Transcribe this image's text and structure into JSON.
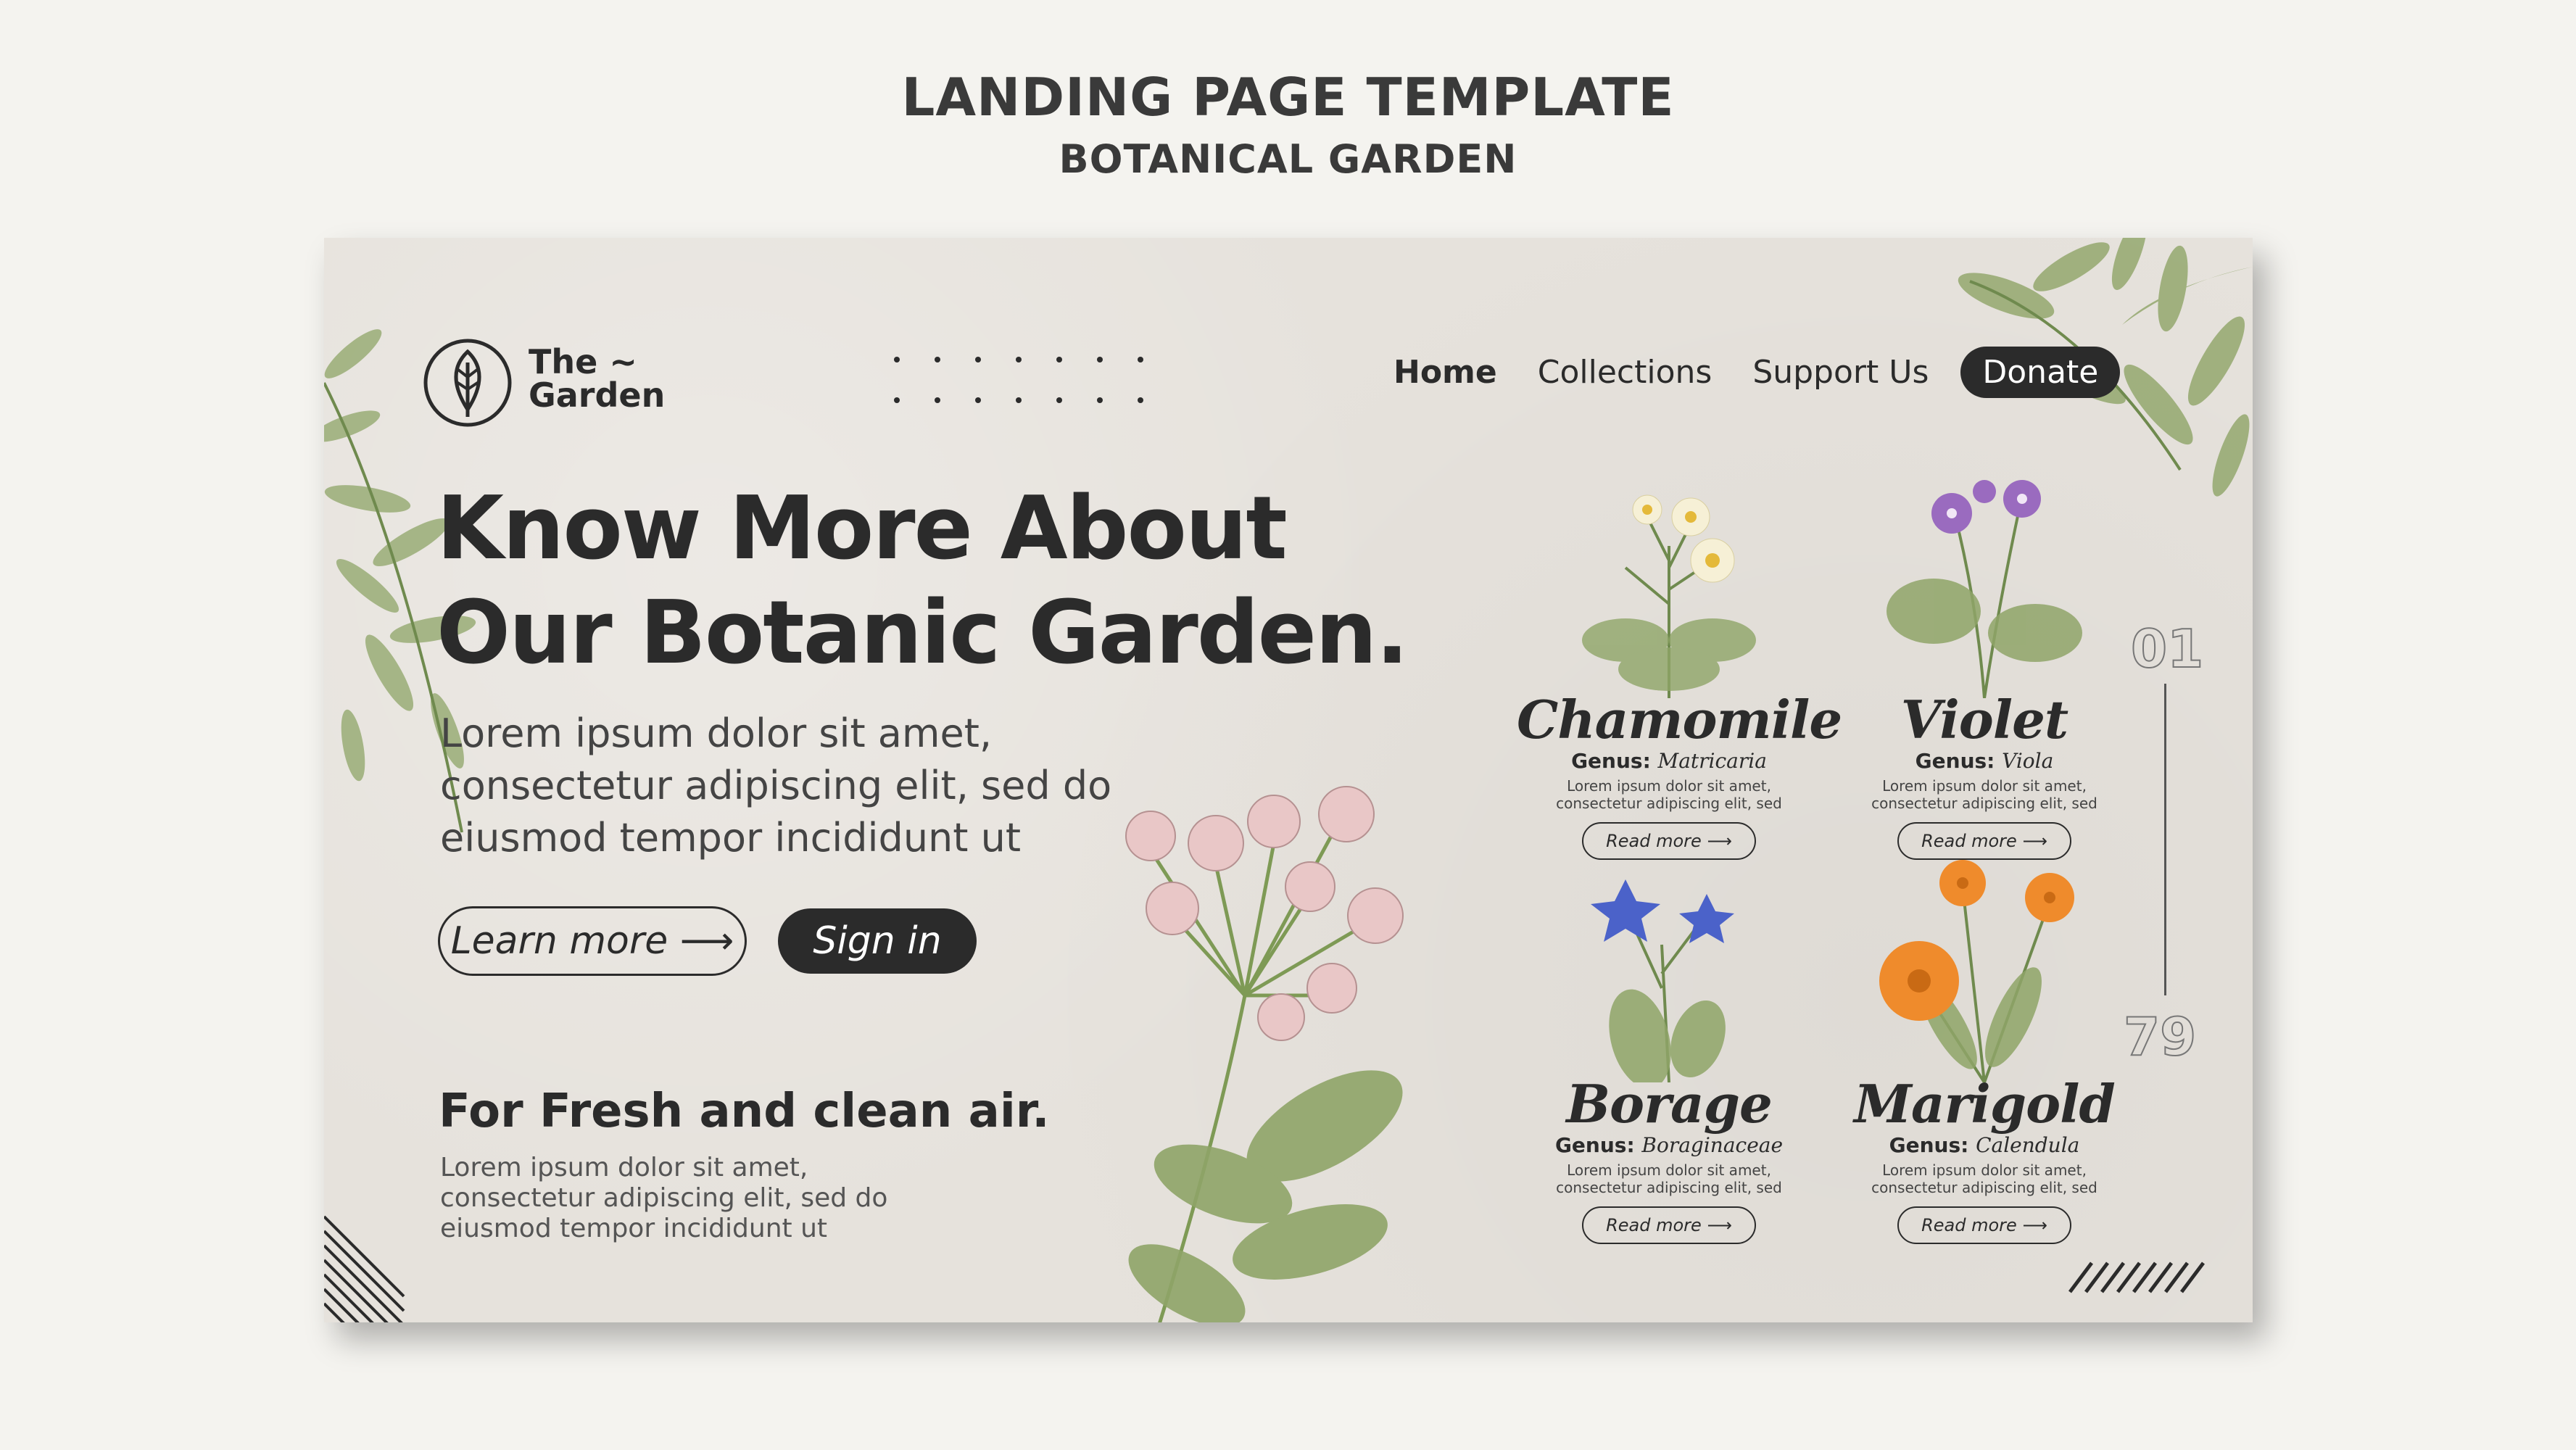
{
  "outer": {
    "title": "LANDING PAGE TEMPLATE",
    "subtitle": "BOTANICAL GARDEN"
  },
  "logo": {
    "line1": "The ~",
    "line2": "Garden",
    "icon": "leaf-icon"
  },
  "nav": {
    "items": [
      "Home",
      "Collections",
      "Support Us"
    ],
    "donate_label": "Donate",
    "active": "Home"
  },
  "hero": {
    "heading_line1": "Know More About",
    "heading_line2": "Our Botanic Garden.",
    "body_line1": "Lorem ipsum dolor sit amet,",
    "body_line2": "consectetur adipiscing elit, sed do",
    "body_line3": "eiusmod tempor incididunt ut",
    "learn_more_label": "Learn more",
    "sign_in_label": "Sign in"
  },
  "fresh": {
    "heading": "For Fresh and clean air.",
    "body_line1": "Lorem ipsum dolor sit amet,",
    "body_line2": "consectetur adipiscing elit, sed do",
    "body_line3": "eiusmod tempor incididunt ut"
  },
  "cards": [
    {
      "name": "Chamomile",
      "genus_label": "Genus:",
      "genus": "Matricaria",
      "desc_line1": "Lorem ipsum dolor sit amet,",
      "desc_line2": "consectetur adipiscing elit, sed",
      "button": "Read more"
    },
    {
      "name": "Violet",
      "genus_label": "Genus:",
      "genus": "Viola",
      "desc_line1": "Lorem ipsum dolor sit amet,",
      "desc_line2": "consectetur adipiscing elit, sed",
      "button": "Read more"
    },
    {
      "name": "Borage",
      "genus_label": "Genus:",
      "genus": "Boraginaceae",
      "desc_line1": "Lorem ipsum dolor sit amet,",
      "desc_line2": "consectetur adipiscing elit, sed",
      "button": "Read more"
    },
    {
      "name": "Marigold",
      "genus_label": "Genus:",
      "genus": "Calendula",
      "desc_line1": "Lorem ipsum dolor sit amet,",
      "desc_line2": "consectetur adipiscing elit, sed",
      "button": "Read more"
    }
  ],
  "pager": {
    "start": "01",
    "end": "79"
  },
  "colors": {
    "card_background": "#e6e2dc",
    "page_background": "#f4f3ef",
    "ink": "#2b2b2b",
    "leaf_green": "#8fa568"
  }
}
